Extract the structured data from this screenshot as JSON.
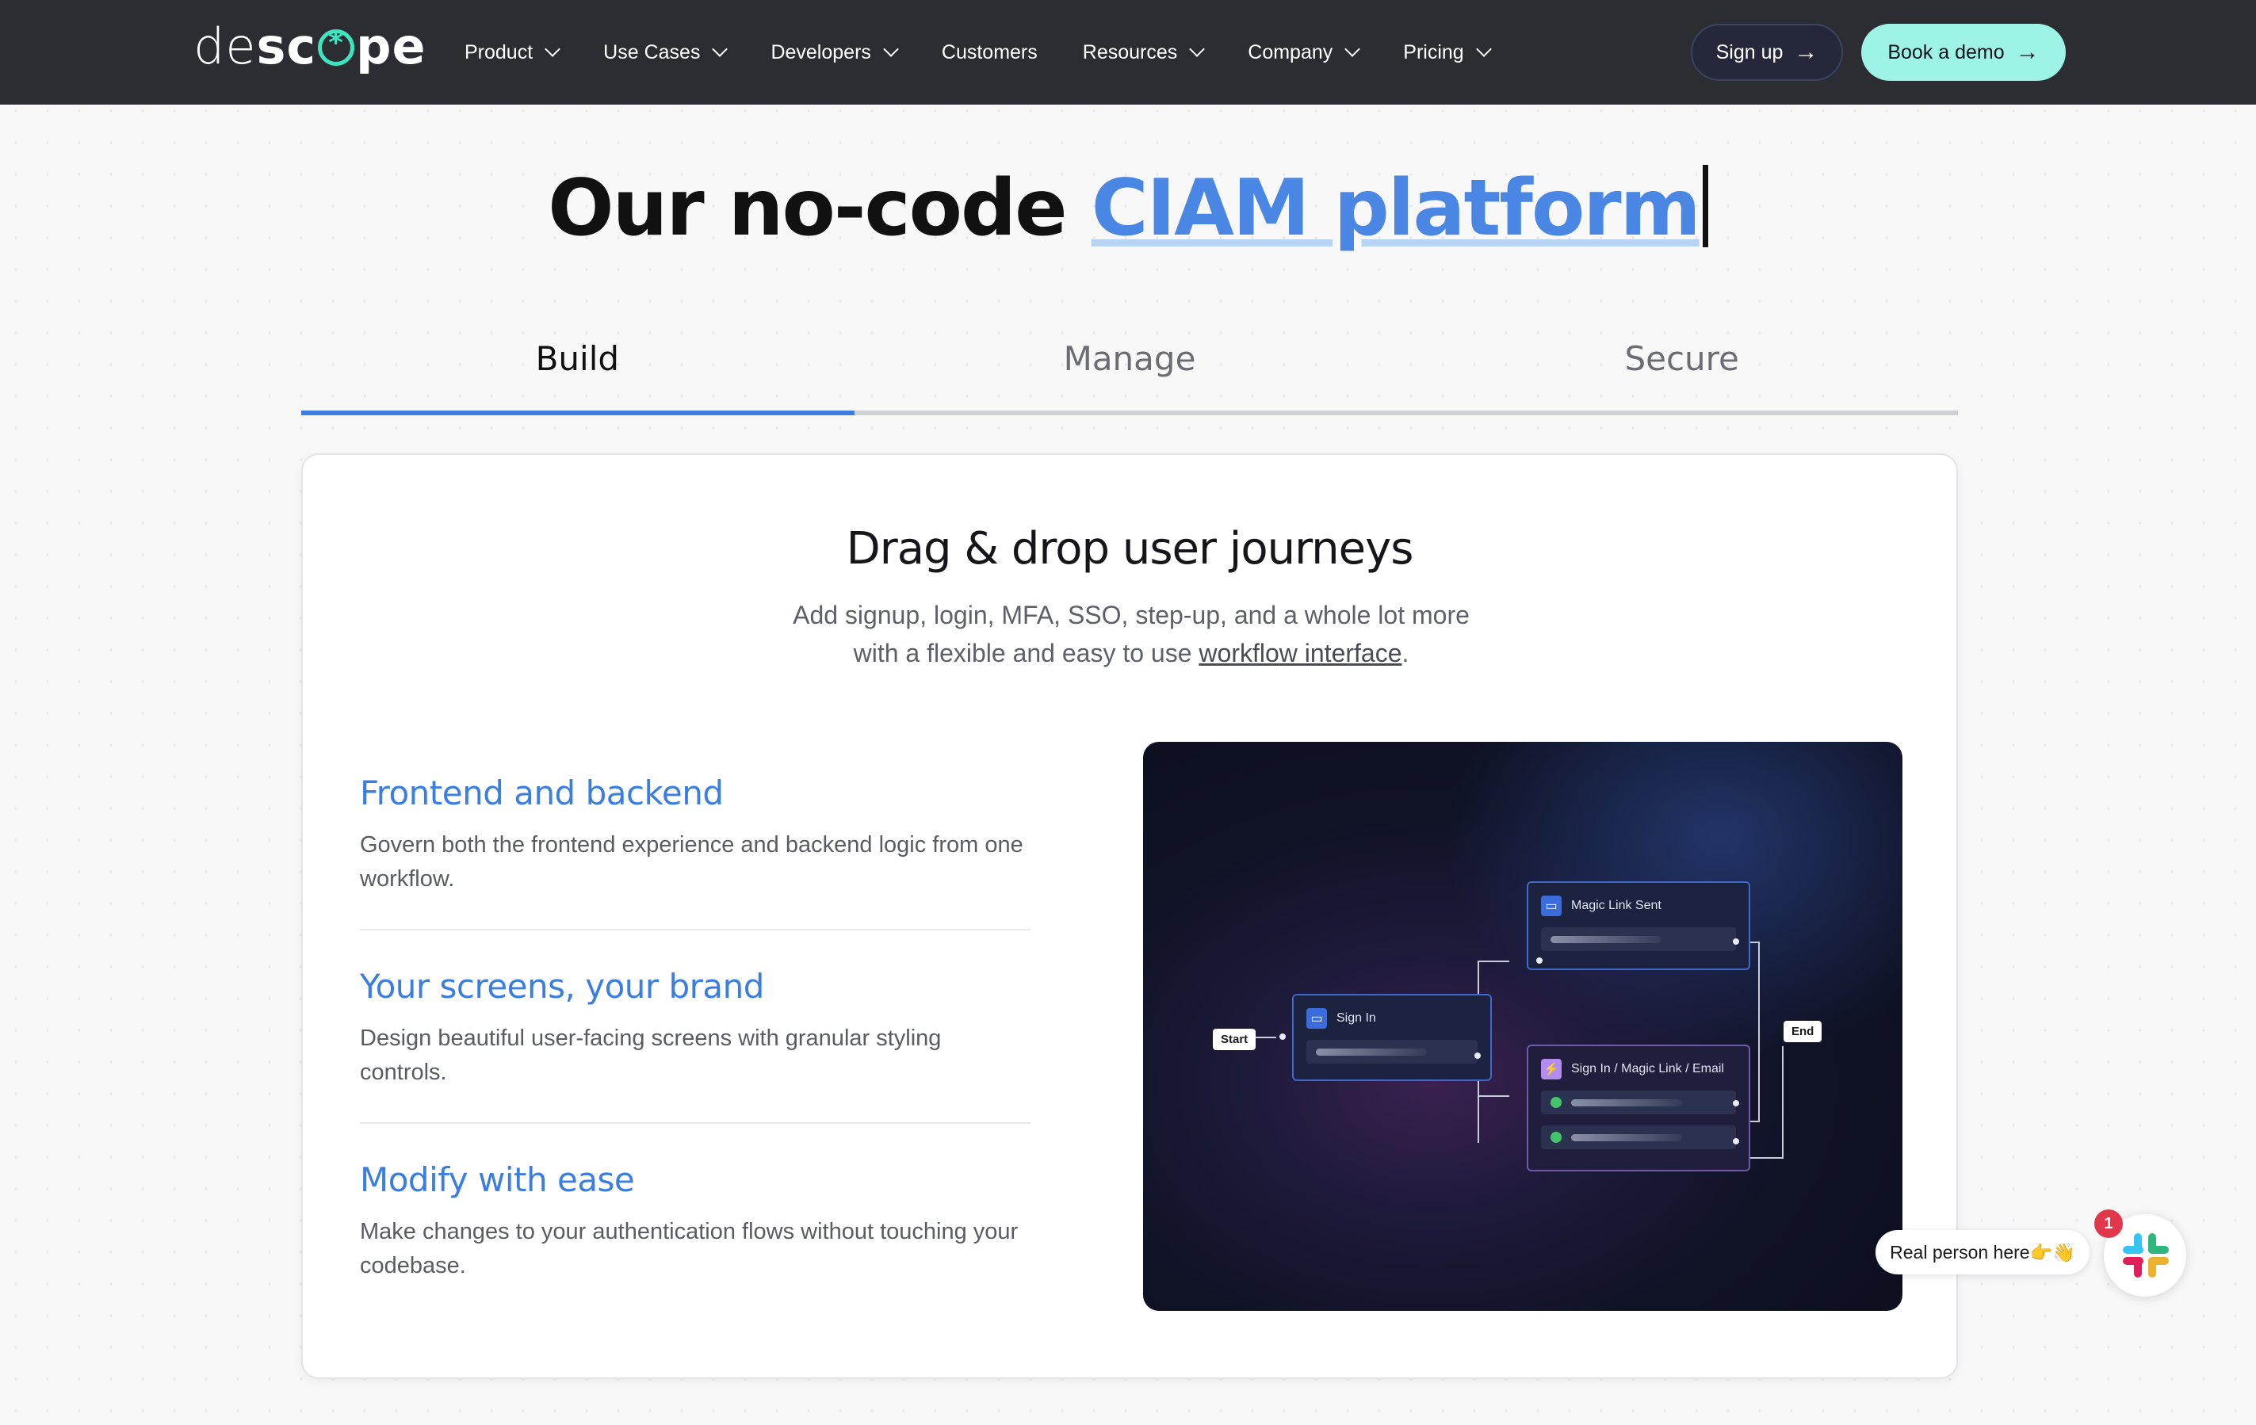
{
  "nav": {
    "logo_light": "de",
    "logo_bold_a": "sc",
    "logo_bold_b": "pe",
    "items": [
      {
        "label": "Product",
        "dropdown": true
      },
      {
        "label": "Use Cases",
        "dropdown": true
      },
      {
        "label": "Developers",
        "dropdown": true
      },
      {
        "label": "Customers",
        "dropdown": false
      },
      {
        "label": "Resources",
        "dropdown": true
      },
      {
        "label": "Company",
        "dropdown": true
      },
      {
        "label": "Pricing",
        "dropdown": true
      }
    ],
    "signup_label": "Sign up",
    "demo_label": "Book a demo",
    "arrow": "→"
  },
  "hero": {
    "title_prefix": "Our no-code ",
    "title_accent": "CIAM platform"
  },
  "tabs": {
    "items": [
      "Build",
      "Manage",
      "Secure"
    ],
    "active": "Build",
    "progress": 0.333
  },
  "card": {
    "title": "Drag & drop user journeys",
    "subtitle_line1": "Add signup, login, MFA, SSO, step-up, and a whole lot more",
    "subtitle_line2_prefix": "with a flexible and easy to use ",
    "subtitle_link": "workflow interface",
    "subtitle_line2_suffix": ".",
    "features": [
      {
        "title": "Frontend and backend",
        "body": "Govern both the frontend experience and backend logic from one workflow."
      },
      {
        "title": "Your screens, your brand",
        "body": "Design beautiful user-facing screens with granular styling controls."
      },
      {
        "title": "Modify with ease",
        "body": "Make changes to your authentication flows without touching your codebase."
      }
    ]
  },
  "flow": {
    "start": "Start",
    "end": "End",
    "sign_in": "Sign In",
    "magic_link_sent": "Magic Link Sent",
    "sign_in_magic": "Sign In / Magic Link / Email"
  },
  "chat": {
    "bubble": "Real person here👉👋",
    "badge": "1"
  },
  "colors": {
    "nav_bg": "#2b2d33",
    "accent": "#3b7ee0",
    "demo_button": "#9cf3e6",
    "logo_mark": "#3fe3c0"
  }
}
